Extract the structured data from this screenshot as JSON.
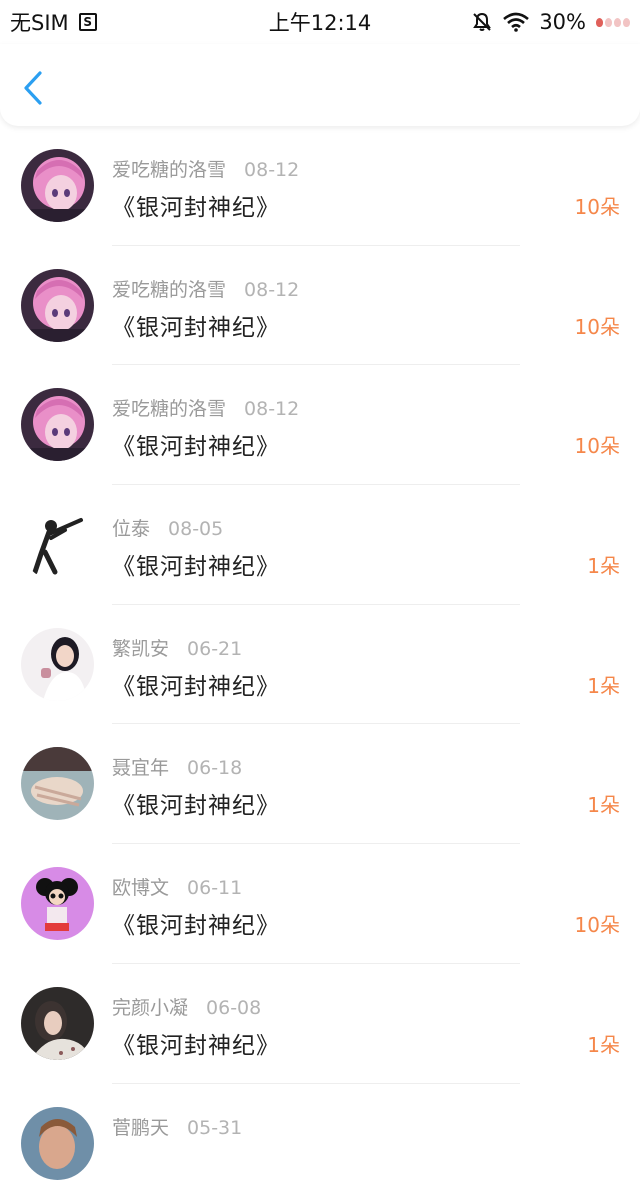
{
  "status_bar": {
    "carrier": "无SIM",
    "time": "上午12:14",
    "battery": "30%"
  },
  "header": {
    "back_icon": "chevron-left-icon",
    "accent": "#2b9ff1"
  },
  "colors": {
    "amount": "#f5874a",
    "name": "#9a9a9a",
    "title": "#222222"
  },
  "items": [
    {
      "name": "爱吃糖的洛雪",
      "date": "08-12",
      "title": "《银河封神纪》",
      "amount": "10朵",
      "avatar": "pink-anime-avatar"
    },
    {
      "name": "爱吃糖的洛雪",
      "date": "08-12",
      "title": "《银河封神纪》",
      "amount": "10朵",
      "avatar": "pink-anime-avatar"
    },
    {
      "name": "爱吃糖的洛雪",
      "date": "08-12",
      "title": "《银河封神纪》",
      "amount": "10朵",
      "avatar": "pink-anime-avatar"
    },
    {
      "name": "位泰",
      "date": "08-05",
      "title": "《银河封神纪》",
      "amount": "1朵",
      "avatar": "shooter-silhouette-avatar"
    },
    {
      "name": "繁凯安",
      "date": "06-21",
      "title": "《银河封神纪》",
      "amount": "1朵",
      "avatar": "girl-photo-avatar"
    },
    {
      "name": "聂宜年",
      "date": "06-18",
      "title": "《银河封神纪》",
      "amount": "1朵",
      "avatar": "hands-photo-avatar"
    },
    {
      "name": "欧博文",
      "date": "06-11",
      "title": "《银河封神纪》",
      "amount": "10朵",
      "avatar": "cartoon-girl-avatar"
    },
    {
      "name": "完颜小凝",
      "date": "06-08",
      "title": "《银河封神纪》",
      "amount": "1朵",
      "avatar": "woman-photo-avatar"
    },
    {
      "name": "菅鹏天",
      "date": "05-31",
      "title": "",
      "amount": "",
      "avatar": "person-photo-avatar"
    }
  ]
}
